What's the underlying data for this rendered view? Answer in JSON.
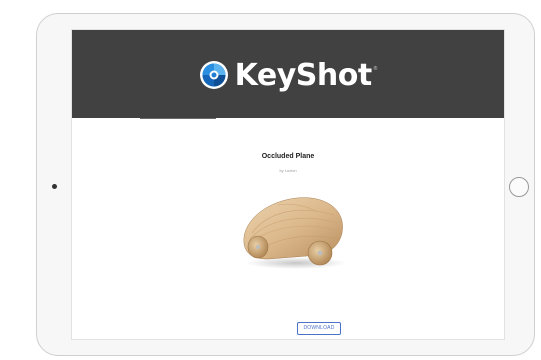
{
  "logo": {
    "text": "KeyShot",
    "trademark": "®",
    "icon": "keyshot-aperture-icon"
  },
  "model": {
    "title": "Occluded Plane",
    "subtitle": "by Luxion",
    "image": "wooden-toy-car-render"
  },
  "actions": {
    "download_label": "DOWNLOAD"
  },
  "device": {
    "home_button_icon": "home-button-circle",
    "camera_icon": "front-camera-dot"
  },
  "colors": {
    "header_bg": "#414141",
    "button_accent": "#4a72c9",
    "logo_blue": "#2a8fe0"
  }
}
